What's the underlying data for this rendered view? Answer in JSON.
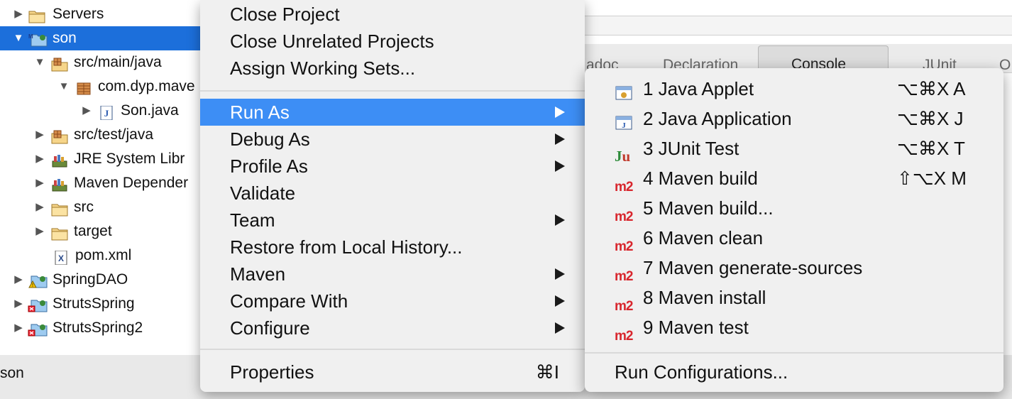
{
  "explorer": {
    "items": [
      {
        "label": "Servers",
        "twisty": "▶",
        "icon": "folder-icon"
      },
      {
        "label": "son",
        "twisty": "▼",
        "icon": "maven-project-icon",
        "selected": true
      },
      {
        "label": "src/main/java",
        "twisty": "▼",
        "icon": "source-folder-icon"
      },
      {
        "label": "com.dyp.mave",
        "twisty": "▼",
        "icon": "package-icon"
      },
      {
        "label": "Son.java",
        "twisty": "▶",
        "icon": "java-file-icon"
      },
      {
        "label": "src/test/java",
        "twisty": "▶",
        "icon": "source-folder-icon"
      },
      {
        "label": "JRE System Libr",
        "twisty": "▶",
        "icon": "library-icon"
      },
      {
        "label": "Maven Depender",
        "twisty": "▶",
        "icon": "library-icon"
      },
      {
        "label": "src",
        "twisty": "▶",
        "icon": "folder-icon"
      },
      {
        "label": "target",
        "twisty": "▶",
        "icon": "folder-icon"
      },
      {
        "label": "pom.xml",
        "twisty": "",
        "icon": "xml-file-icon"
      },
      {
        "label": "SpringDAO",
        "twisty": "▶",
        "icon": "project-warning-icon"
      },
      {
        "label": "StrutsSpring",
        "twisty": "▶",
        "icon": "project-error-icon"
      },
      {
        "label": "StrutsSpring2",
        "twisty": "▶",
        "icon": "project-error-icon"
      }
    ]
  },
  "status_bar": {
    "text": "son"
  },
  "background_tabs": {
    "tab1": "adoc",
    "tab2": "Declaration",
    "console": "Console",
    "junit": "JUnit",
    "tail": "O"
  },
  "context_menu": {
    "close_project": "Close Project",
    "close_unrelated": "Close Unrelated Projects",
    "assign_working_sets": "Assign Working Sets...",
    "run_as": "Run As",
    "debug_as": "Debug As",
    "profile_as": "Profile As",
    "validate": "Validate",
    "team": "Team",
    "restore_local_history": "Restore from Local History...",
    "maven": "Maven",
    "compare_with": "Compare With",
    "configure": "Configure",
    "properties": "Properties",
    "properties_shortcut": "⌘I"
  },
  "submenu": {
    "items": [
      {
        "label": "1 Java Applet",
        "shortcut": "⌥⌘X A",
        "icon": "java-applet-icon"
      },
      {
        "label": "2 Java Application",
        "shortcut": "⌥⌘X J",
        "icon": "java-application-icon"
      },
      {
        "label": "3 JUnit Test",
        "shortcut": "⌥⌘X T",
        "icon": "junit-icon",
        "icon_text": "Ju"
      },
      {
        "label": "4 Maven build",
        "shortcut": "⇧⌥X M",
        "icon": "maven-m2-icon",
        "icon_text": "m2"
      },
      {
        "label": "5 Maven build...",
        "shortcut": "",
        "icon": "maven-m2-icon",
        "icon_text": "m2"
      },
      {
        "label": "6 Maven clean",
        "shortcut": "",
        "icon": "maven-m2-icon",
        "icon_text": "m2"
      },
      {
        "label": "7 Maven generate-sources",
        "shortcut": "",
        "icon": "maven-m2-icon",
        "icon_text": "m2"
      },
      {
        "label": "8 Maven install",
        "shortcut": "",
        "icon": "maven-m2-icon",
        "icon_text": "m2"
      },
      {
        "label": "9 Maven test",
        "shortcut": "",
        "icon": "maven-m2-icon",
        "icon_text": "m2"
      }
    ],
    "run_configurations": "Run Configurations..."
  },
  "colors": {
    "selection": "#1c6fdb",
    "menu_highlight": "#3d8ef5",
    "maven_red": "#d8262d",
    "junit_green": "#2e8b3a"
  }
}
